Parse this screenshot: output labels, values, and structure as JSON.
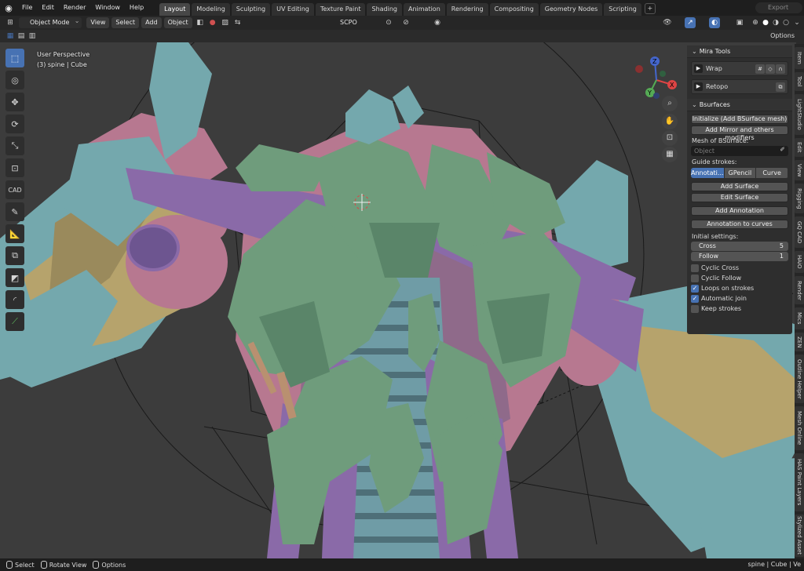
{
  "topbar": {
    "logo_icon": "blender-logo-icon",
    "menus": [
      "File",
      "Edit",
      "Render",
      "Window",
      "Help"
    ],
    "workspaces": [
      "Layout",
      "Modeling",
      "Sculpting",
      "UV Editing",
      "Texture Paint",
      "Shading",
      "Animation",
      "Rendering",
      "Compositing",
      "Geometry Nodes",
      "Scripting"
    ],
    "active_workspace": "Layout",
    "add_workspace": "+",
    "export_label": "Export"
  },
  "header": {
    "mode": "Object Mode",
    "menus": [
      "View",
      "Select",
      "Add",
      "Object"
    ],
    "addon_label": "SCPO",
    "options": "Options"
  },
  "viewport": {
    "perspective": "User Perspective",
    "object_info": "(3) spine | Cube",
    "gizmo_axes": [
      "X",
      "Y",
      "Z"
    ]
  },
  "toolbar": {
    "tools": [
      "select-box-icon",
      "cursor-icon",
      "move-icon",
      "rotate-icon",
      "scale-icon",
      "transform-icon",
      "cad-icon",
      "annotate-icon",
      "measure-icon",
      "add-cube-icon",
      "extrude-icon",
      "bevel-icon",
      "loop-cut-icon"
    ],
    "cad_label": "CAD"
  },
  "npanel": {
    "mira_title": "Mira Tools",
    "wrap_label": "Wrap",
    "retopo_label": "Retopo",
    "bsurf_title": "Bsurfaces",
    "init_btn": "Initialize (Add BSurface mesh)",
    "mirror_btn": "Add Mirror and others modifiers",
    "mesh_label": "Mesh of BSurface:",
    "object_placeholder": "Object",
    "guide_label": "Guide strokes:",
    "guide_options": [
      "Annotati...",
      "GPencil",
      "Curve"
    ],
    "add_surface": "Add Surface",
    "edit_surface": "Edit Surface",
    "add_annotation": "Add Annotation",
    "annotation_curves": "Annotation to curves",
    "initial_label": "Initial settings:",
    "cross_label": "Cross",
    "cross_value": "5",
    "follow_label": "Follow",
    "follow_value": "1",
    "checks": [
      {
        "label": "Cyclic Cross",
        "checked": false
      },
      {
        "label": "Cyclic Follow",
        "checked": false
      },
      {
        "label": "Loops on strokes",
        "checked": true
      },
      {
        "label": "Automatic join",
        "checked": true
      },
      {
        "label": "Keep strokes",
        "checked": false
      }
    ]
  },
  "vtabs": [
    "Item",
    "Tool",
    "LightStudio",
    "Edit",
    "View",
    "Rigging",
    "GQ CAD",
    "HAiO",
    "Render",
    "Mics",
    "ZEN",
    "Outline Helper",
    "Mesh Online",
    "HAS Paint Layers",
    "Stylized Asset"
  ],
  "statusbar": {
    "select": "Select",
    "rotate": "Rotate View",
    "options": "Options",
    "right": "spine | Cube | Ve"
  },
  "colors": {
    "accent": "#4772b3",
    "mesh_green": "#6f9c7c",
    "mesh_teal": "#74a8ad",
    "mesh_purple": "#8a6aa8",
    "mesh_pink": "#b77890",
    "mesh_yellow": "#b6a36c"
  }
}
